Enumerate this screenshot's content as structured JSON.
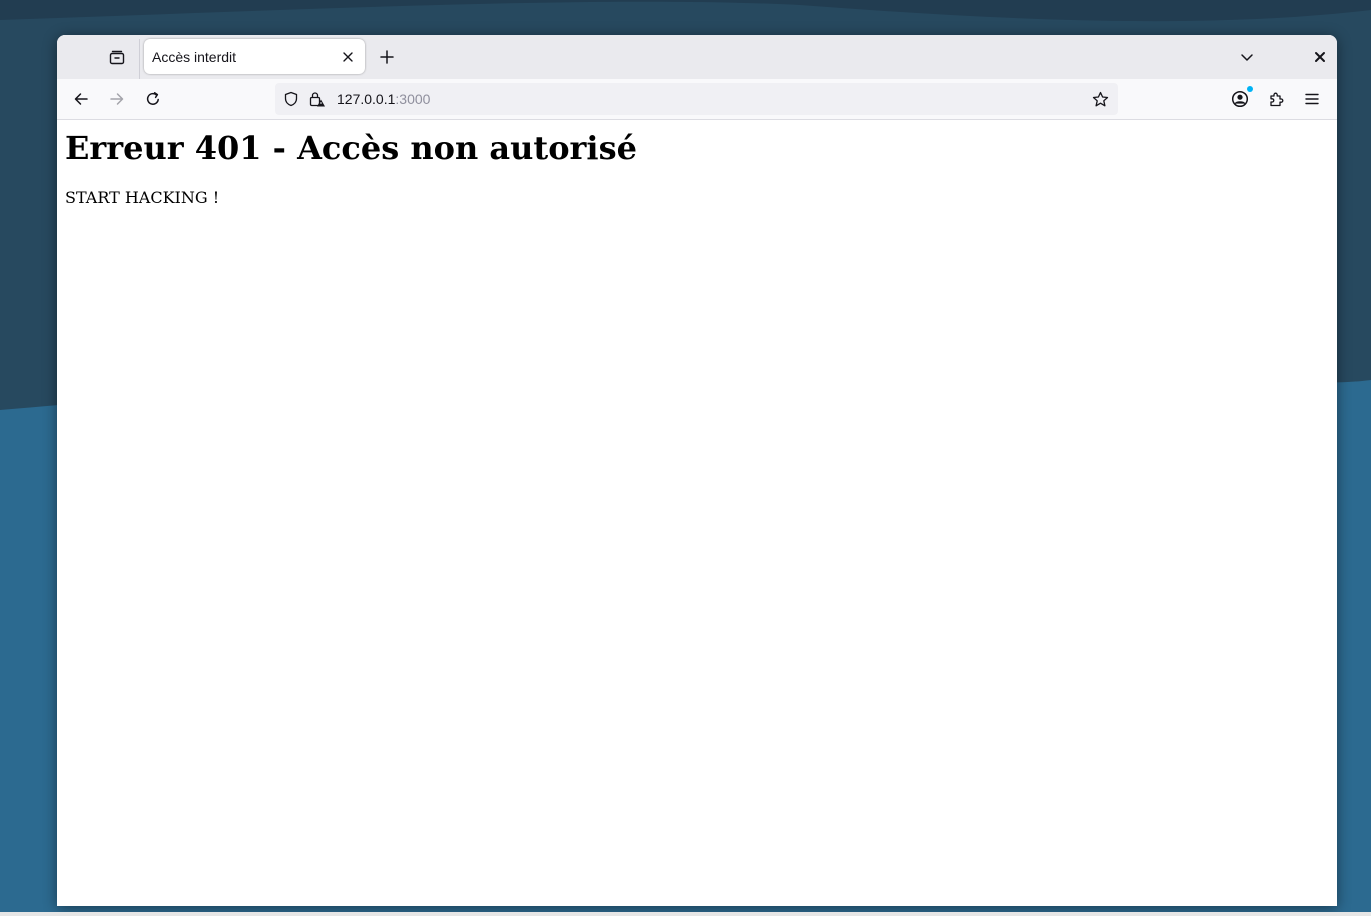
{
  "desktop": {
    "colors": {
      "dark": "#26475f",
      "light": "#2f6b91"
    }
  },
  "browser": {
    "tab": {
      "title": "Accès interdit",
      "overview_icon": "tab-overview-icon",
      "close_icon": "close-icon"
    },
    "new_tab_icon": "plus-icon",
    "tab_list_icon": "chevron-down-icon",
    "window_close_icon": "close-icon",
    "nav": {
      "back_icon": "arrow-left-icon",
      "forward_icon": "arrow-right-icon",
      "reload_icon": "reload-icon"
    },
    "urlbar": {
      "host": "127.0.0.1",
      "port": ":3000",
      "tracking_icon": "shield-icon",
      "security_icon": "lock-warning-icon",
      "bookmark_icon": "star-icon"
    },
    "toolbar": {
      "account_icon": "account-icon",
      "extensions_icon": "puzzle-icon",
      "menu_icon": "hamburger-menu-icon"
    }
  },
  "page": {
    "heading": "Erreur 401 - Accès non autorisé",
    "text": "START HACKING !"
  }
}
